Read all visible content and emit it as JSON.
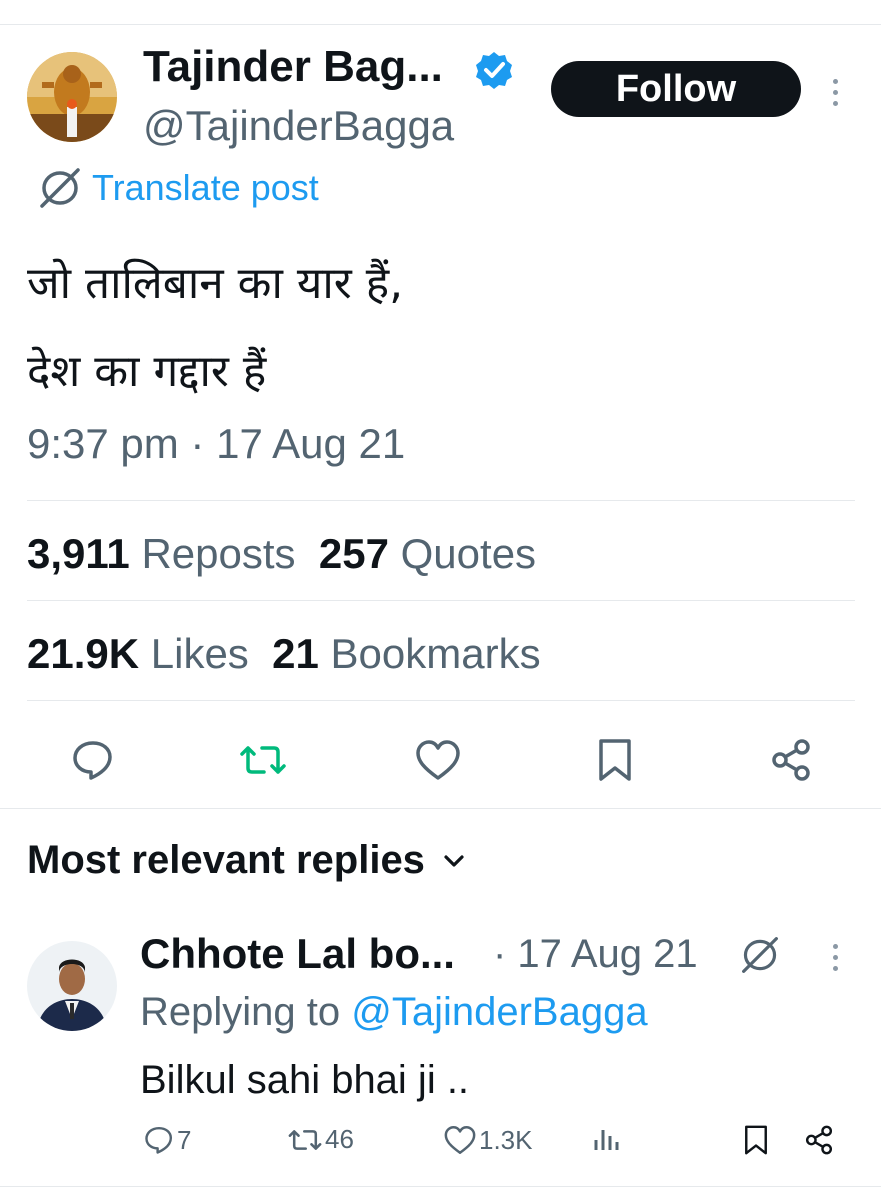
{
  "post": {
    "author_name": "Tajinder Bag...",
    "author_handle": "@TajinderBagga",
    "follow_label": "Follow",
    "translate_label": "Translate post",
    "text_line1": "जो तालिबान का यार हैं,",
    "text_line2": "देश का गद्दार हैं",
    "timestamp": "9:37 pm · 17 Aug 21",
    "reposts_count": "3,911",
    "reposts_label": "Reposts",
    "quotes_count": "257",
    "quotes_label": "Quotes",
    "likes_count": "21.9K",
    "likes_label": "Likes",
    "bookmarks_count": "21",
    "bookmarks_label": "Bookmarks"
  },
  "replies_section": {
    "title": "Most relevant replies"
  },
  "reply": {
    "author_name": "Chhote Lal bo...",
    "date": "· 17 Aug 21",
    "replying_prefix": "Replying to",
    "replying_handle": "@TajinderBagga",
    "text": "Bilkul sahi bhai ji ..",
    "reply_count": "7",
    "repost_count": "46",
    "like_count": "1.3K"
  },
  "colors": {
    "verified": "#1d9bf0",
    "link": "#1d9bf0",
    "repost_active": "#00ba7c",
    "text_primary": "#0f1419",
    "text_secondary": "#536471"
  },
  "icons": [
    "verified-badge-icon",
    "translate-icon",
    "more-icon",
    "reply-icon",
    "repost-icon",
    "like-icon",
    "bookmark-icon",
    "share-icon",
    "views-icon",
    "chevron-down-icon"
  ]
}
